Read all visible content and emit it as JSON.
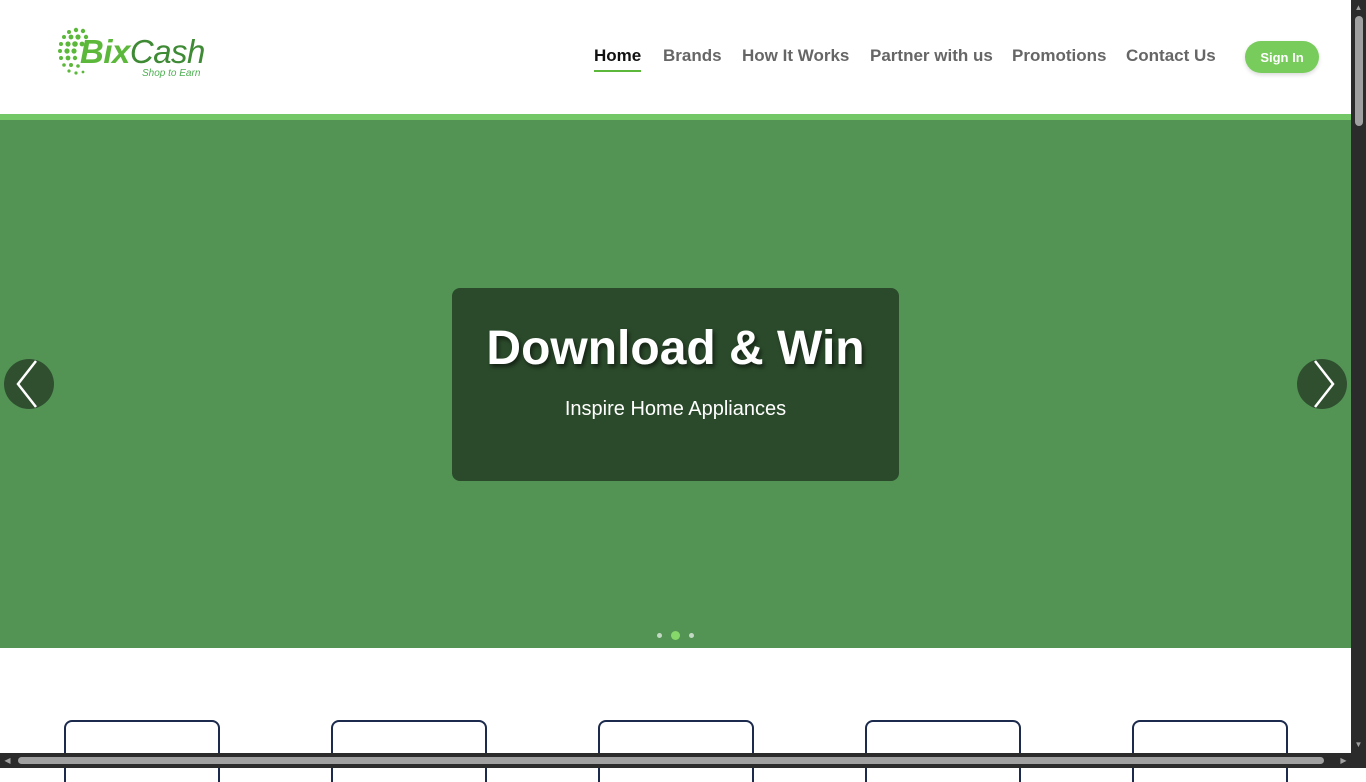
{
  "logo": {
    "brand_bix": "Bix",
    "brand_cash": "Cash",
    "tagline": "Shop to Earn"
  },
  "nav": {
    "items": [
      {
        "label": "Home",
        "active": true
      },
      {
        "label": "Brands",
        "active": false
      },
      {
        "label": "How It Works",
        "active": false
      },
      {
        "label": "Partner with us",
        "active": false
      },
      {
        "label": "Promotions",
        "active": false
      },
      {
        "label": "Contact Us",
        "active": false
      }
    ],
    "signin_label": "Sign In"
  },
  "hero": {
    "title": "Download & Win",
    "subtitle": "Inspire Home Appliances",
    "slide_count": 3,
    "active_slide": 2
  },
  "colors": {
    "brand_green": "#5cb83a",
    "hero_bg": "#539455",
    "hero_card_bg": "#2b4a2b",
    "signin_bg": "#78cc5c",
    "card_border": "#1c2a4d"
  },
  "cards_visible": 5
}
